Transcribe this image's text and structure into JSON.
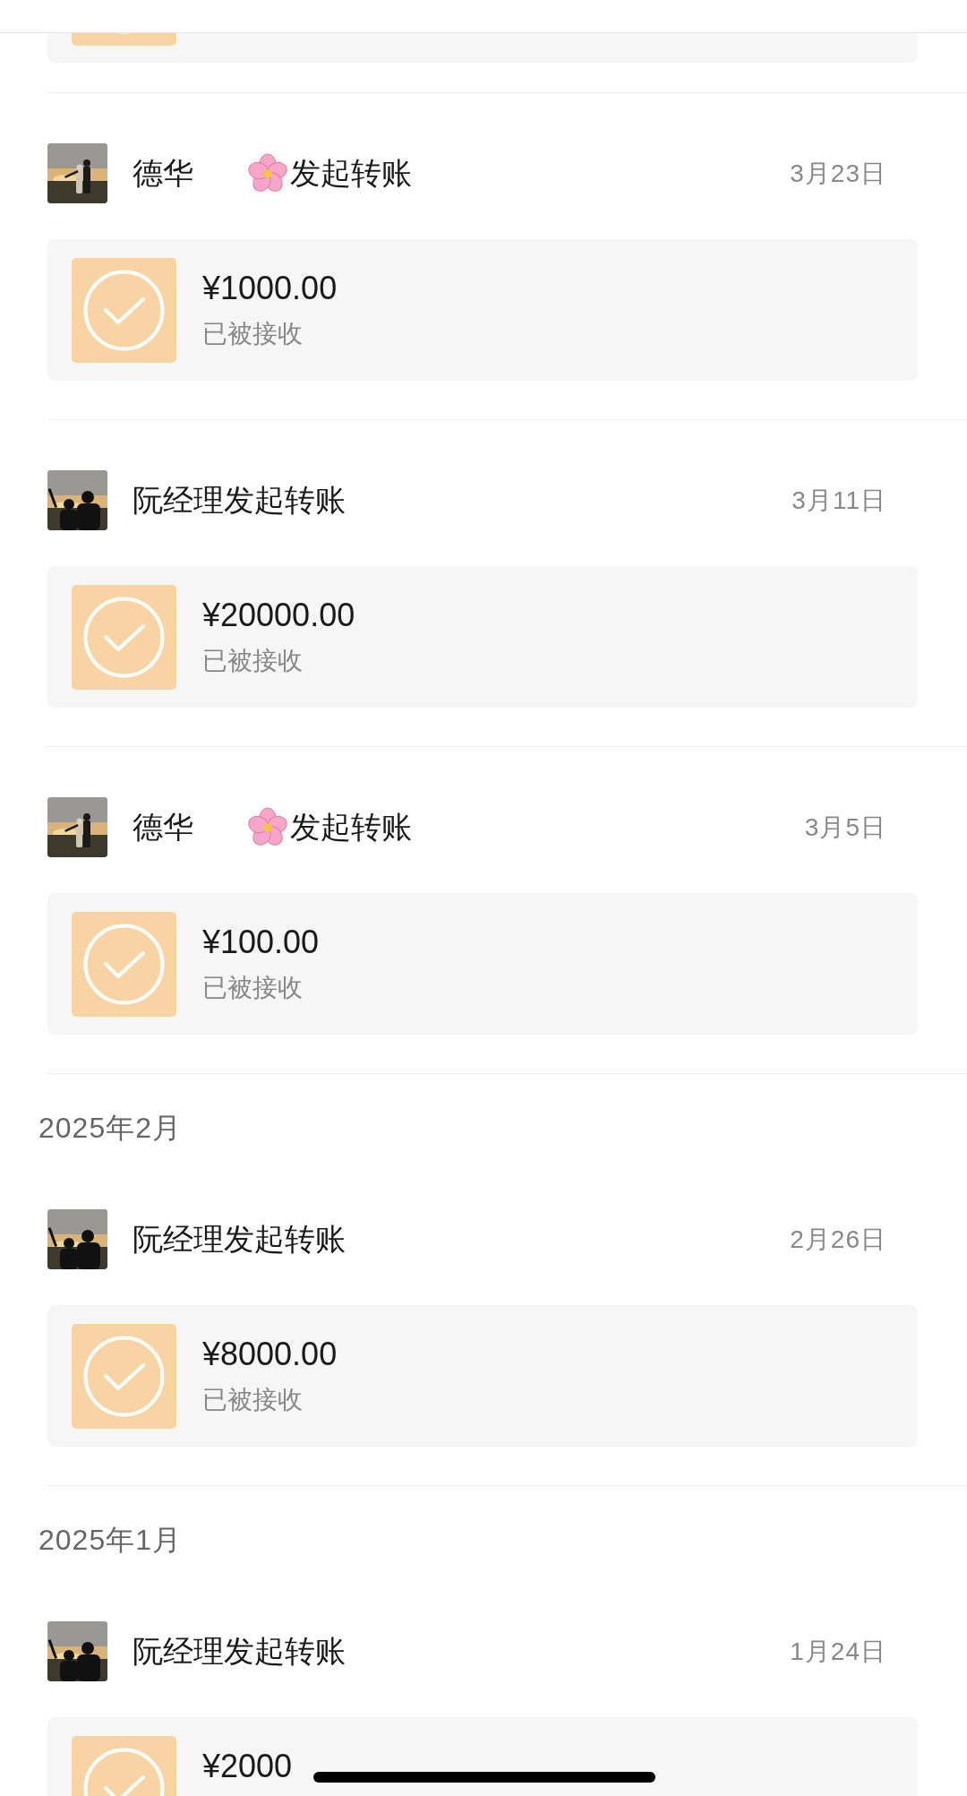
{
  "sections": [
    {
      "transfers": [
        {
          "kind": "emoji_name",
          "name": "德华",
          "title": "发起转账",
          "date": "3月23日",
          "amount": "¥1000.00",
          "status": "已被接收"
        },
        {
          "kind": "plain",
          "title": "阮经理发起转账",
          "date": "3月11日",
          "amount": "¥20000.00",
          "status": "已被接收"
        },
        {
          "kind": "emoji_name",
          "name": "德华",
          "title": "发起转账",
          "date": "3月5日",
          "amount": "¥100.00",
          "status": "已被接收"
        }
      ]
    },
    {
      "month": "2025年2月",
      "transfers": [
        {
          "kind": "plain",
          "title": "阮经理发起转账",
          "date": "2月26日",
          "amount": "¥8000.00",
          "status": "已被接收"
        }
      ]
    },
    {
      "month": "2025年1月",
      "transfers": [
        {
          "kind": "plain",
          "title": "阮经理发起转账",
          "date": "1月24日",
          "amount": "¥2000"
        }
      ]
    }
  ]
}
